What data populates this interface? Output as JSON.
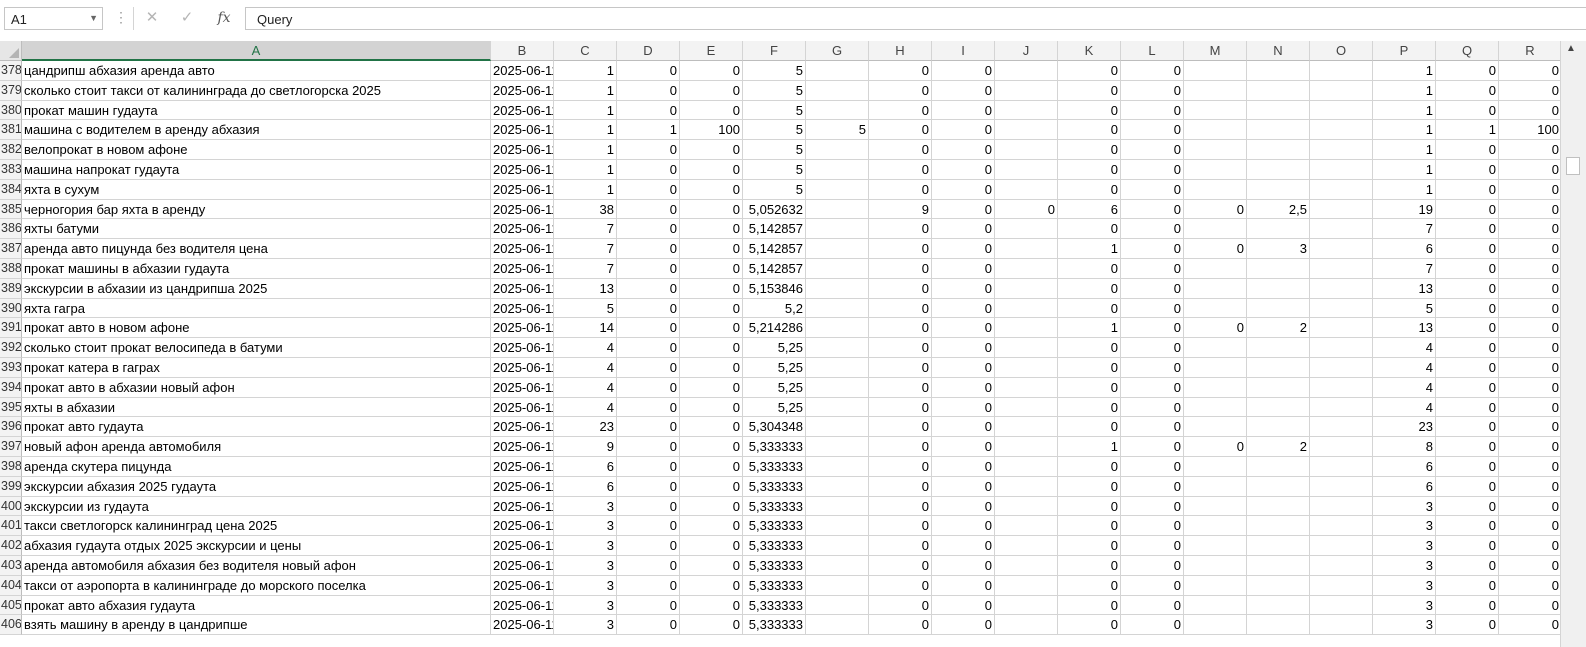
{
  "formula_bar": {
    "name_box": "A1",
    "cancel_icon": "close-icon",
    "enter_icon": "checkmark-icon",
    "function_label": "fx",
    "formula": "Query"
  },
  "columns": [
    "A",
    "B",
    "C",
    "D",
    "E",
    "F",
    "G",
    "H",
    "I",
    "J",
    "K",
    "L",
    "M",
    "N",
    "O",
    "P",
    "Q",
    "R"
  ],
  "selected_column": "A",
  "accent_color": "#217346",
  "rows": [
    {
      "n": "378",
      "cells": [
        "цандрипш абхазия аренда авто",
        "2025-06-11",
        "1",
        "0",
        "0",
        "5",
        "",
        "0",
        "0",
        "",
        "0",
        "0",
        "",
        "",
        "",
        "1",
        "0",
        "0"
      ]
    },
    {
      "n": "379",
      "cells": [
        "сколько стоит такси от калининграда до светлогорска 2025",
        "2025-06-11",
        "1",
        "0",
        "0",
        "5",
        "",
        "0",
        "0",
        "",
        "0",
        "0",
        "",
        "",
        "",
        "1",
        "0",
        "0"
      ]
    },
    {
      "n": "380",
      "cells": [
        "прокат машин гудаута",
        "2025-06-11",
        "1",
        "0",
        "0",
        "5",
        "",
        "0",
        "0",
        "",
        "0",
        "0",
        "",
        "",
        "",
        "1",
        "0",
        "0"
      ]
    },
    {
      "n": "381",
      "cells": [
        "машина с водителем в аренду абхазия",
        "2025-06-11",
        "1",
        "1",
        "100",
        "5",
        "5",
        "0",
        "0",
        "",
        "0",
        "0",
        "",
        "",
        "",
        "1",
        "1",
        "100"
      ]
    },
    {
      "n": "382",
      "cells": [
        "велопрокат в новом афоне",
        "2025-06-11",
        "1",
        "0",
        "0",
        "5",
        "",
        "0",
        "0",
        "",
        "0",
        "0",
        "",
        "",
        "",
        "1",
        "0",
        "0"
      ]
    },
    {
      "n": "383",
      "cells": [
        "машина напрокат гудаута",
        "2025-06-11",
        "1",
        "0",
        "0",
        "5",
        "",
        "0",
        "0",
        "",
        "0",
        "0",
        "",
        "",
        "",
        "1",
        "0",
        "0"
      ]
    },
    {
      "n": "384",
      "cells": [
        "яхта в сухум",
        "2025-06-11",
        "1",
        "0",
        "0",
        "5",
        "",
        "0",
        "0",
        "",
        "0",
        "0",
        "",
        "",
        "",
        "1",
        "0",
        "0"
      ]
    },
    {
      "n": "385",
      "cells": [
        "черногория бар яхта в аренду",
        "2025-06-11",
        "38",
        "0",
        "0",
        "5,052632",
        "",
        "9",
        "0",
        "0",
        "6",
        "0",
        "0",
        "2,5",
        "",
        "19",
        "0",
        "0"
      ]
    },
    {
      "n": "386",
      "cells": [
        "яхты батуми",
        "2025-06-11",
        "7",
        "0",
        "0",
        "5,142857",
        "",
        "0",
        "0",
        "",
        "0",
        "0",
        "",
        "",
        "",
        "7",
        "0",
        "0"
      ]
    },
    {
      "n": "387",
      "cells": [
        "аренда авто пицунда без водителя цена",
        "2025-06-11",
        "7",
        "0",
        "0",
        "5,142857",
        "",
        "0",
        "0",
        "",
        "1",
        "0",
        "0",
        "3",
        "",
        "6",
        "0",
        "0"
      ]
    },
    {
      "n": "388",
      "cells": [
        "прокат машины в абхазии гудаута",
        "2025-06-11",
        "7",
        "0",
        "0",
        "5,142857",
        "",
        "0",
        "0",
        "",
        "0",
        "0",
        "",
        "",
        "",
        "7",
        "0",
        "0"
      ]
    },
    {
      "n": "389",
      "cells": [
        "экскурсии в абхазии из цандрипша 2025",
        "2025-06-11",
        "13",
        "0",
        "0",
        "5,153846",
        "",
        "0",
        "0",
        "",
        "0",
        "0",
        "",
        "",
        "",
        "13",
        "0",
        "0"
      ]
    },
    {
      "n": "390",
      "cells": [
        "яхта гагра",
        "2025-06-11",
        "5",
        "0",
        "0",
        "5,2",
        "",
        "0",
        "0",
        "",
        "0",
        "0",
        "",
        "",
        "",
        "5",
        "0",
        "0"
      ]
    },
    {
      "n": "391",
      "cells": [
        "прокат авто в новом афоне",
        "2025-06-11",
        "14",
        "0",
        "0",
        "5,214286",
        "",
        "0",
        "0",
        "",
        "1",
        "0",
        "0",
        "2",
        "",
        "13",
        "0",
        "0"
      ]
    },
    {
      "n": "392",
      "cells": [
        "сколько стоит прокат велосипеда в батуми",
        "2025-06-11",
        "4",
        "0",
        "0",
        "5,25",
        "",
        "0",
        "0",
        "",
        "0",
        "0",
        "",
        "",
        "",
        "4",
        "0",
        "0"
      ]
    },
    {
      "n": "393",
      "cells": [
        "прокат катера в гаграх",
        "2025-06-11",
        "4",
        "0",
        "0",
        "5,25",
        "",
        "0",
        "0",
        "",
        "0",
        "0",
        "",
        "",
        "",
        "4",
        "0",
        "0"
      ]
    },
    {
      "n": "394",
      "cells": [
        "прокат авто в абхазии новый афон",
        "2025-06-11",
        "4",
        "0",
        "0",
        "5,25",
        "",
        "0",
        "0",
        "",
        "0",
        "0",
        "",
        "",
        "",
        "4",
        "0",
        "0"
      ]
    },
    {
      "n": "395",
      "cells": [
        "яхты в абхазии",
        "2025-06-11",
        "4",
        "0",
        "0",
        "5,25",
        "",
        "0",
        "0",
        "",
        "0",
        "0",
        "",
        "",
        "",
        "4",
        "0",
        "0"
      ]
    },
    {
      "n": "396",
      "cells": [
        "прокат авто гудаута",
        "2025-06-11",
        "23",
        "0",
        "0",
        "5,304348",
        "",
        "0",
        "0",
        "",
        "0",
        "0",
        "",
        "",
        "",
        "23",
        "0",
        "0"
      ]
    },
    {
      "n": "397",
      "cells": [
        "новый афон аренда автомобиля",
        "2025-06-11",
        "9",
        "0",
        "0",
        "5,333333",
        "",
        "0",
        "0",
        "",
        "1",
        "0",
        "0",
        "2",
        "",
        "8",
        "0",
        "0"
      ]
    },
    {
      "n": "398",
      "cells": [
        "аренда скутера пицунда",
        "2025-06-11",
        "6",
        "0",
        "0",
        "5,333333",
        "",
        "0",
        "0",
        "",
        "0",
        "0",
        "",
        "",
        "",
        "6",
        "0",
        "0"
      ]
    },
    {
      "n": "399",
      "cells": [
        "экскурсии абхазия 2025 гудаута",
        "2025-06-11",
        "6",
        "0",
        "0",
        "5,333333",
        "",
        "0",
        "0",
        "",
        "0",
        "0",
        "",
        "",
        "",
        "6",
        "0",
        "0"
      ]
    },
    {
      "n": "400",
      "cells": [
        "экскурсии из гудаута",
        "2025-06-11",
        "3",
        "0",
        "0",
        "5,333333",
        "",
        "0",
        "0",
        "",
        "0",
        "0",
        "",
        "",
        "",
        "3",
        "0",
        "0"
      ]
    },
    {
      "n": "401",
      "cells": [
        "такси светлогорск калининград цена 2025",
        "2025-06-11",
        "3",
        "0",
        "0",
        "5,333333",
        "",
        "0",
        "0",
        "",
        "0",
        "0",
        "",
        "",
        "",
        "3",
        "0",
        "0"
      ]
    },
    {
      "n": "402",
      "cells": [
        "абхазия гудаута отдых 2025 экскурсии и цены",
        "2025-06-11",
        "3",
        "0",
        "0",
        "5,333333",
        "",
        "0",
        "0",
        "",
        "0",
        "0",
        "",
        "",
        "",
        "3",
        "0",
        "0"
      ]
    },
    {
      "n": "403",
      "cells": [
        "аренда автомобиля абхазия без водителя новый афон",
        "2025-06-11",
        "3",
        "0",
        "0",
        "5,333333",
        "",
        "0",
        "0",
        "",
        "0",
        "0",
        "",
        "",
        "",
        "3",
        "0",
        "0"
      ]
    },
    {
      "n": "404",
      "cells": [
        "такси от аэропорта в калининграде до морского поселка",
        "2025-06-11",
        "3",
        "0",
        "0",
        "5,333333",
        "",
        "0",
        "0",
        "",
        "0",
        "0",
        "",
        "",
        "",
        "3",
        "0",
        "0"
      ]
    },
    {
      "n": "405",
      "cells": [
        "прокат авто абхазия гудаута",
        "2025-06-11",
        "3",
        "0",
        "0",
        "5,333333",
        "",
        "0",
        "0",
        "",
        "0",
        "0",
        "",
        "",
        "",
        "3",
        "0",
        "0"
      ]
    },
    {
      "n": "406",
      "cells": [
        "взять машину в аренду в цандрипше",
        "2025-06-11",
        "3",
        "0",
        "0",
        "5,333333",
        "",
        "0",
        "0",
        "",
        "0",
        "0",
        "",
        "",
        "",
        "3",
        "0",
        "0"
      ]
    }
  ]
}
